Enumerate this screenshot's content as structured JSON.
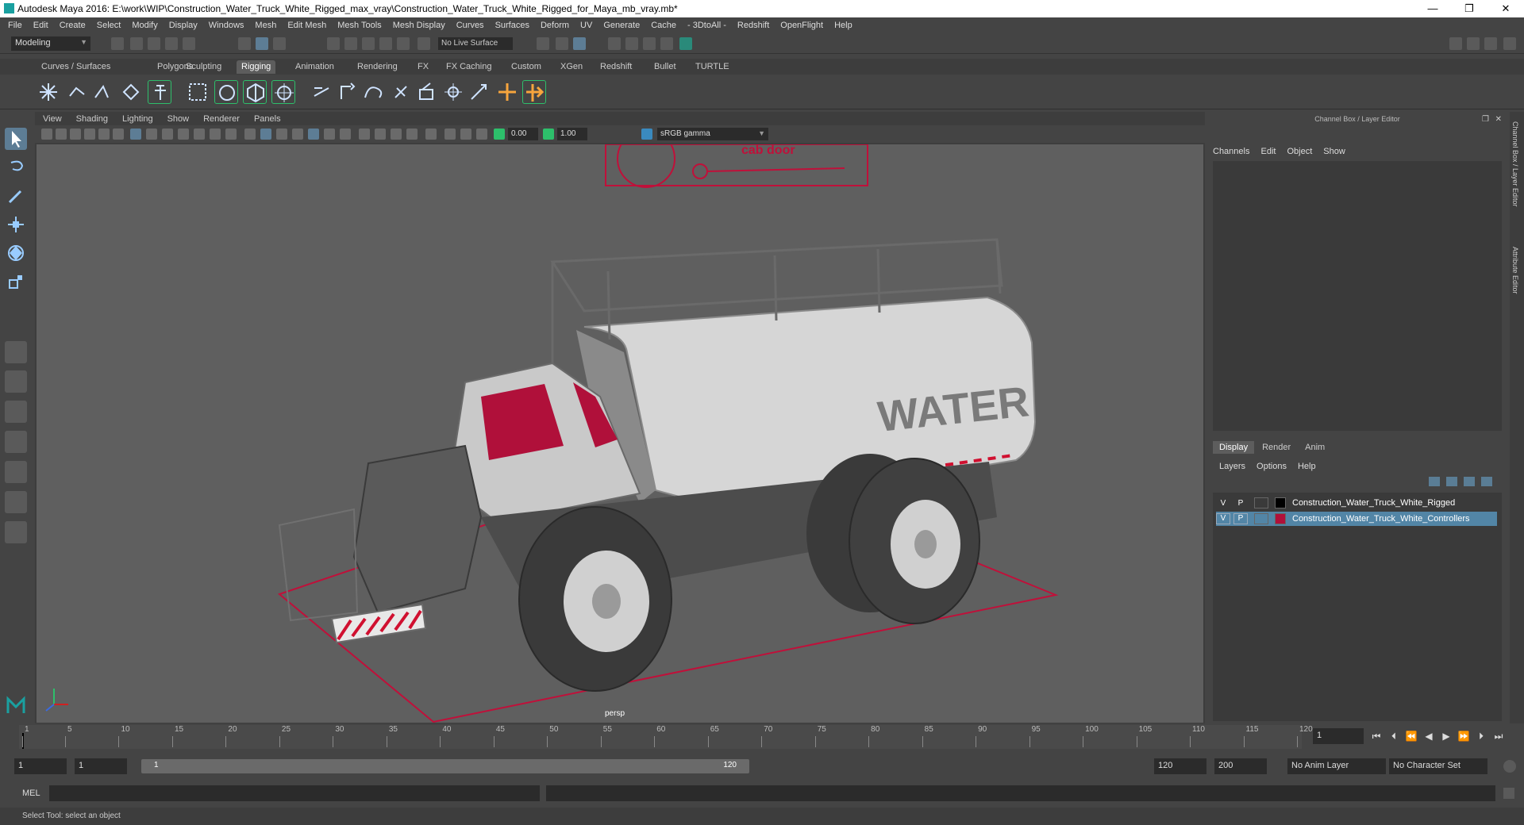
{
  "window": {
    "title": "Autodesk Maya 2016: E:\\work\\WIP\\Construction_Water_Truck_White_Rigged_max_vray\\Construction_Water_Truck_White_Rigged_for_Maya_mb_vray.mb*",
    "minimize": "—",
    "restore": "❐",
    "close": "✕"
  },
  "menubar": [
    "File",
    "Edit",
    "Create",
    "Select",
    "Modify",
    "Display",
    "Windows",
    "Mesh",
    "Edit Mesh",
    "Mesh Tools",
    "Mesh Display",
    "Curves",
    "Surfaces",
    "Deform",
    "UV",
    "Generate",
    "Cache",
    "- 3DtoAll -",
    "Redshift",
    "OpenFlight",
    "Help"
  ],
  "statusline": {
    "mode": "Modeling",
    "live_surface": "No Live Surface"
  },
  "shelf_tabs": [
    "Curves / Surfaces",
    "Polygons",
    "Sculpting",
    "Rigging",
    "Animation",
    "Rendering",
    "FX",
    "FX Caching",
    "Custom",
    "XGen",
    "Redshift",
    "Bullet",
    "TURTLE"
  ],
  "active_shelf": "Rigging",
  "viewport": {
    "menu": [
      "View",
      "Shading",
      "Lighting",
      "Show",
      "Renderer",
      "Panels"
    ],
    "exposure": "0.00",
    "gamma": "1.00",
    "color_space": "sRGB gamma",
    "camera_label": "persp",
    "scene_text_water": "WATER",
    "scene_text_door": "cab door"
  },
  "channel_box": {
    "title": "Channel Box / Layer Editor",
    "menu": [
      "Channels",
      "Edit",
      "Object",
      "Show"
    ]
  },
  "layer_editor": {
    "tabs": [
      "Display",
      "Render",
      "Anim"
    ],
    "active_tab": "Display",
    "menu": [
      "Layers",
      "Options",
      "Help"
    ],
    "layers": [
      {
        "v": "V",
        "p": "P",
        "color": "#000000",
        "name": "Construction_Water_Truck_White_Rigged",
        "selected": false
      },
      {
        "v": "V",
        "p": "P",
        "color": "#b0103a",
        "name": "Construction_Water_Truck_White_Controllers",
        "selected": true
      }
    ]
  },
  "side_tabs": [
    "Channel Box / Layer Editor",
    "Attribute Editor"
  ],
  "timeline": {
    "labels": [
      "1",
      "5",
      "10",
      "15",
      "20",
      "25",
      "30",
      "35",
      "40",
      "45",
      "50",
      "55",
      "60",
      "65",
      "70",
      "75",
      "80",
      "85",
      "90",
      "95",
      "100",
      "105",
      "110",
      "115",
      "120"
    ],
    "current_frame": "1"
  },
  "range": {
    "start": "1",
    "inner_start": "1",
    "slider_start": "1",
    "slider_end": "120",
    "end": "120",
    "outer_end": "200",
    "anim_layer": "No Anim Layer",
    "character_set": "No Character Set"
  },
  "command_line": {
    "label": "MEL"
  },
  "help_line": "Select Tool: select an object",
  "colors": {
    "accent_selected": "#5285a6",
    "controller_red": "#b0103a",
    "ground_rig_red": "#c0103a"
  }
}
